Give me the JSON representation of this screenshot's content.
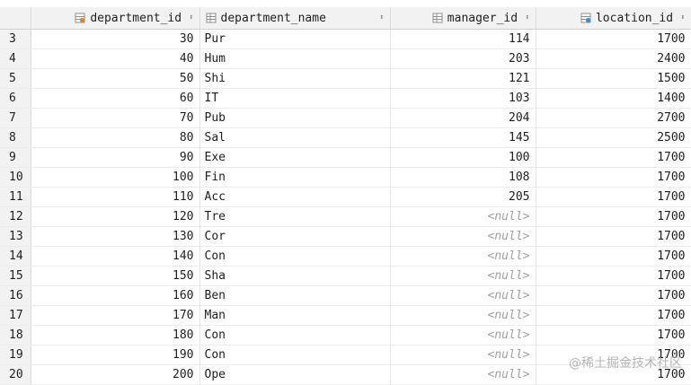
{
  "columns": [
    {
      "name": "department_id",
      "icon": "key-column-icon"
    },
    {
      "name": "department_name",
      "icon": "column-icon"
    },
    {
      "name": "manager_id",
      "icon": "column-icon"
    },
    {
      "name": "location_id",
      "icon": "foreign-key-column-icon"
    }
  ],
  "null_text": "<null>",
  "rows": [
    {
      "row": "3",
      "department_id": "30",
      "department_name": "Pur",
      "manager_id": "114",
      "location_id": "1700"
    },
    {
      "row": "4",
      "department_id": "40",
      "department_name": "Hum",
      "manager_id": "203",
      "location_id": "2400"
    },
    {
      "row": "5",
      "department_id": "50",
      "department_name": "Shi",
      "manager_id": "121",
      "location_id": "1500"
    },
    {
      "row": "6",
      "department_id": "60",
      "department_name": "IT",
      "manager_id": "103",
      "location_id": "1400"
    },
    {
      "row": "7",
      "department_id": "70",
      "department_name": "Pub",
      "manager_id": "204",
      "location_id": "2700"
    },
    {
      "row": "8",
      "department_id": "80",
      "department_name": "Sal",
      "manager_id": "145",
      "location_id": "2500"
    },
    {
      "row": "9",
      "department_id": "90",
      "department_name": "Exe",
      "manager_id": "100",
      "location_id": "1700"
    },
    {
      "row": "10",
      "department_id": "100",
      "department_name": "Fin",
      "manager_id": "108",
      "location_id": "1700"
    },
    {
      "row": "11",
      "department_id": "110",
      "department_name": "Acc",
      "manager_id": "205",
      "location_id": "1700"
    },
    {
      "row": "12",
      "department_id": "120",
      "department_name": "Tre",
      "manager_id": null,
      "location_id": "1700"
    },
    {
      "row": "13",
      "department_id": "130",
      "department_name": "Cor",
      "manager_id": null,
      "location_id": "1700"
    },
    {
      "row": "14",
      "department_id": "140",
      "department_name": "Con",
      "manager_id": null,
      "location_id": "1700"
    },
    {
      "row": "15",
      "department_id": "150",
      "department_name": "Sha",
      "manager_id": null,
      "location_id": "1700"
    },
    {
      "row": "16",
      "department_id": "160",
      "department_name": "Ben",
      "manager_id": null,
      "location_id": "1700"
    },
    {
      "row": "17",
      "department_id": "170",
      "department_name": "Man",
      "manager_id": null,
      "location_id": "1700"
    },
    {
      "row": "18",
      "department_id": "180",
      "department_name": "Con",
      "manager_id": null,
      "location_id": "1700"
    },
    {
      "row": "19",
      "department_id": "190",
      "department_name": "Con",
      "manager_id": null,
      "location_id": "1700"
    },
    {
      "row": "20",
      "department_id": "200",
      "department_name": "Ope",
      "manager_id": null,
      "location_id": "1700"
    }
  ],
  "watermark": "@稀土掘金技术社区",
  "colors": {
    "header_bg": "#f2f2f2",
    "null_text": "#a0a0a0",
    "key_icon": "#d08a2a",
    "fk_icon": "#3b8ed6"
  }
}
